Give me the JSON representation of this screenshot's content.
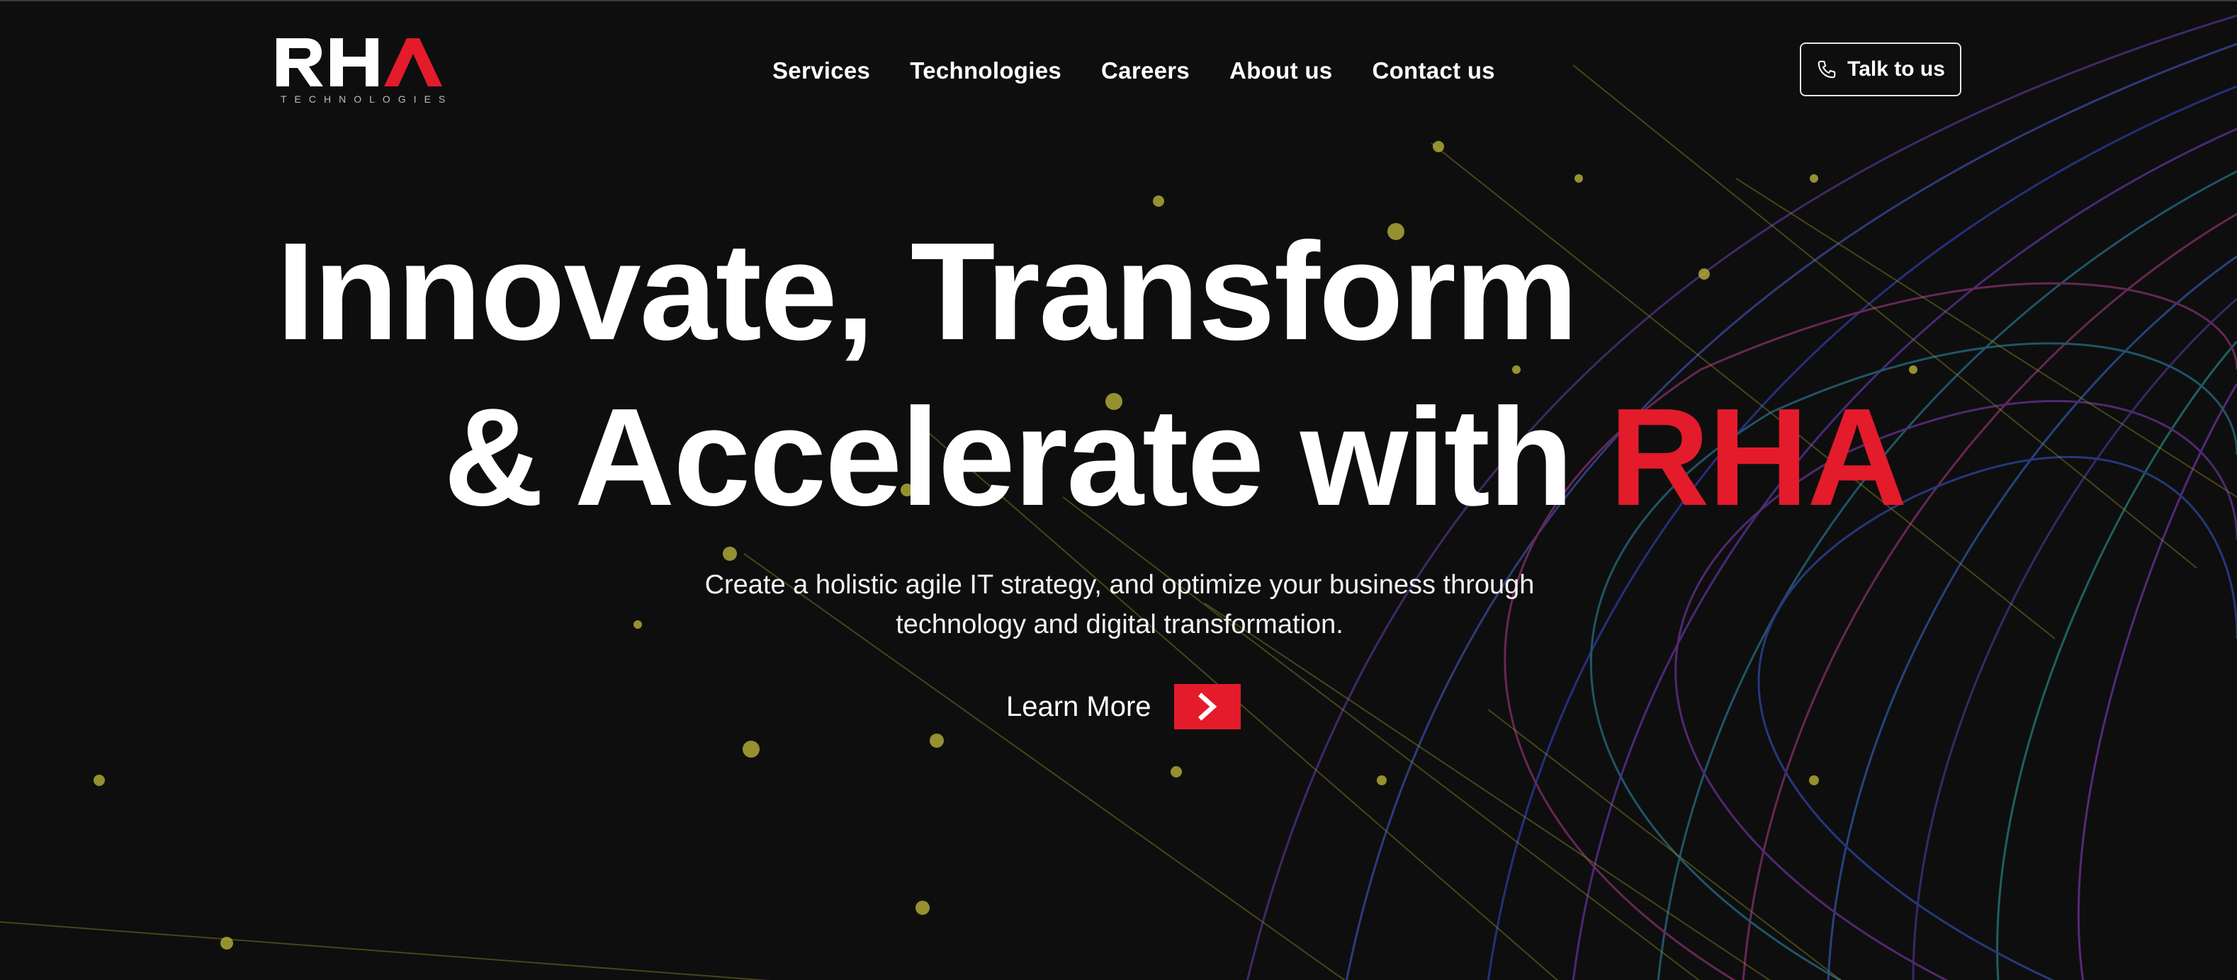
{
  "brand": {
    "logo_text": "RHA",
    "logo_subtext": "TECHNOLOGIES",
    "accent_color": "#e31b2b"
  },
  "nav": {
    "items": [
      {
        "label": "Services"
      },
      {
        "label": "Technologies"
      },
      {
        "label": "Careers"
      },
      {
        "label": "About us"
      },
      {
        "label": "Contact us"
      }
    ],
    "cta_label": "Talk to us",
    "cta_icon": "phone-icon"
  },
  "hero": {
    "line1": "Innovate, Transform",
    "line2_prefix": "& Accelerate with",
    "line2_accent": "RHA",
    "subtitle_line1": "Create a holistic agile IT strategy, and optimize your business through",
    "subtitle_line2": "technology and digital transformation.",
    "learn_more_label": "Learn More",
    "learn_more_icon": "chevron-right-icon"
  }
}
